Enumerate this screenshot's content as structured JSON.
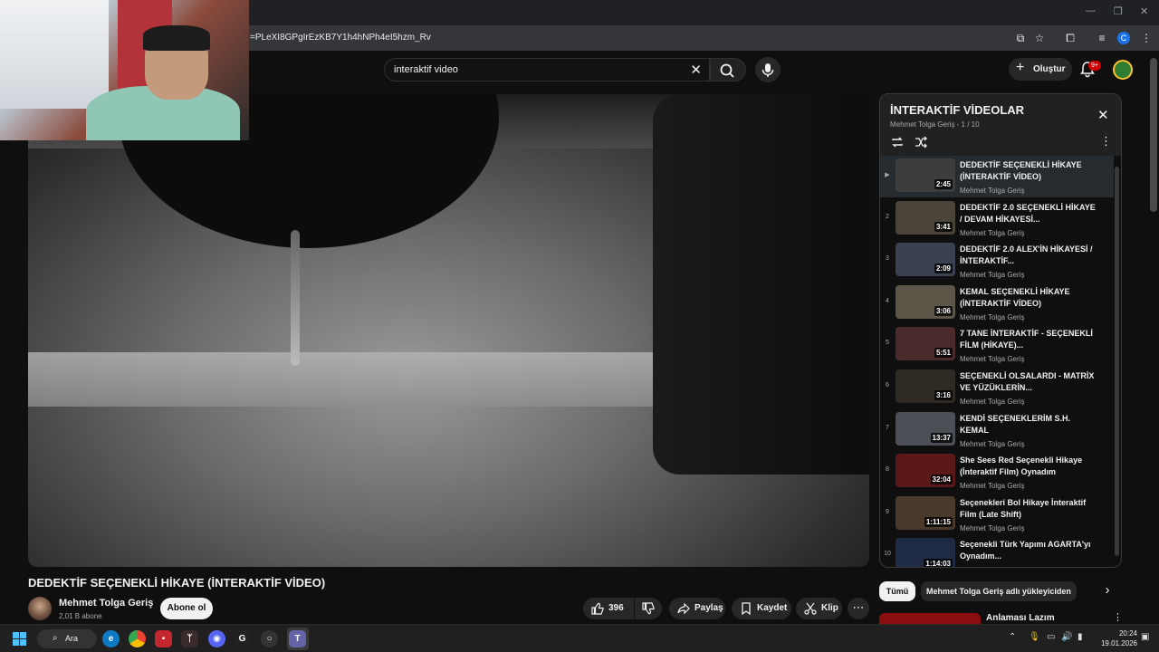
{
  "browser": {
    "url": "=PLeXI8GPgIrEzKB7Y1h4hNPh4eI5hzm_Rv",
    "profile_initial": "C"
  },
  "header": {
    "search_query": "interaktif video",
    "create_label": "Oluştur",
    "notification_badge": "9+"
  },
  "video": {
    "title": "DEDEKTİF SEÇENEKLİ HİKAYE (İNTERAKTİF VİDEO)",
    "channel": "Mehmet Tolga Geriş",
    "subscribers": "2,01 B abone",
    "subscribe_label": "Abone ol",
    "likes": "396",
    "share_label": "Paylaş",
    "save_label": "Kaydet",
    "clip_label": "Klip"
  },
  "playlist": {
    "title": "İNTERAKTİF VİDEOLAR",
    "subtitle": "Mehmet Tolga Geriş - 1 / 10",
    "items": [
      {
        "index": "▶",
        "title": "DEDEKTİF SEÇENEKLİ HİKAYE (İNTERAKTİF VİDEO)",
        "channel": "Mehmet Tolga Geriş",
        "duration": "2:45",
        "thumb": "#3d3d3d"
      },
      {
        "index": "2",
        "title": "DEDEKTİF 2.0 SEÇENEKLİ HİKAYE / DEVAM HİKAYESİ...",
        "channel": "Mehmet Tolga Geriş",
        "duration": "3:41",
        "thumb": "#4a4538"
      },
      {
        "index": "3",
        "title": "DEDEKTİF 2.0 ALEX'İN HİKAYESİ / İNTERAKTİF...",
        "channel": "Mehmet Tolga Geriş",
        "duration": "2:09",
        "thumb": "#3a4150"
      },
      {
        "index": "4",
        "title": "KEMAL SEÇENEKLİ HİKAYE (İNTERAKTİF VİDEO)",
        "channel": "Mehmet Tolga Geriş",
        "duration": "3:06",
        "thumb": "#5b5648"
      },
      {
        "index": "5",
        "title": "7 TANE İNTERAKTİF - SEÇENEKLİ FİLM (HİKAYE)...",
        "channel": "Mehmet Tolga Geriş",
        "duration": "5:51",
        "thumb": "#4a2a2a"
      },
      {
        "index": "6",
        "title": "SEÇENEKLİ OLSALARDI - MATRİX VE YÜZÜKLERİN...",
        "channel": "Mehmet Tolga Geriş",
        "duration": "3:16",
        "thumb": "#2f2a24"
      },
      {
        "index": "7",
        "title": "KENDİ SEÇENEKLERİM S.H. KEMAL",
        "channel": "Mehmet Tolga Geriş",
        "duration": "13:37",
        "thumb": "#4c4f55"
      },
      {
        "index": "8",
        "title": "She Sees Red Seçenekli Hikaye (İnteraktif Film) Oynadım",
        "channel": "Mehmet Tolga Geriş",
        "duration": "32:04",
        "thumb": "#5a1818"
      },
      {
        "index": "9",
        "title": "Seçenekleri Bol Hikaye İnteraktif Film (Late Shift)",
        "channel": "Mehmet Tolga Geriş",
        "duration": "1:11:15",
        "thumb": "#4a3a2c"
      },
      {
        "index": "10",
        "title": "Seçenekli Türk Yapımı AGARTA'yı Oynadım...",
        "channel": "Mehmet Tolga Geriş",
        "duration": "1:14:03",
        "thumb": "#1f2b45"
      }
    ]
  },
  "chips": {
    "all": "Tümü",
    "uploader": "Mehmet Tolga Geriş adlı yükleyiciden"
  },
  "recommendation": {
    "title": "Anlaması Lazım"
  },
  "taskbar": {
    "search_label": "Ara",
    "time": "20:24",
    "date": "19.01.2026"
  }
}
